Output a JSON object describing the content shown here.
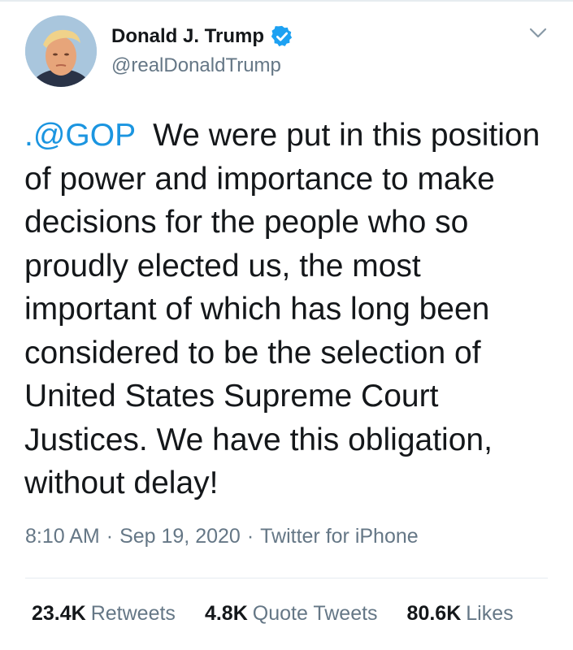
{
  "tweet": {
    "author": {
      "display_name": "Donald J. Trump",
      "handle": "@realDonaldTrump",
      "verified": true,
      "avatar_icon": "profile-photo-avatar"
    },
    "menu_icon": "chevron-down-icon",
    "mention": ".@GOP",
    "body": "  We were put in this position of power and importance to make decisions for the people who so proudly elected us, the most important of which has long been considered to be the selection of United States Supreme Court Justices. We have this obligation, without delay!",
    "meta": {
      "time": "8:10 AM",
      "separator": "·",
      "date": "Sep 19, 2020",
      "source": "Twitter for iPhone"
    },
    "stats": {
      "retweets_count": "23.4K",
      "retweets_label": "Retweets",
      "quotes_count": "4.8K",
      "quotes_label": "Quote Tweets",
      "likes_count": "80.6K",
      "likes_label": "Likes"
    }
  },
  "colors": {
    "link": "#1b95e0",
    "verified": "#1da1f2",
    "secondary_text": "#657786",
    "primary_text": "#14171a",
    "divider": "#e6ecf0"
  }
}
